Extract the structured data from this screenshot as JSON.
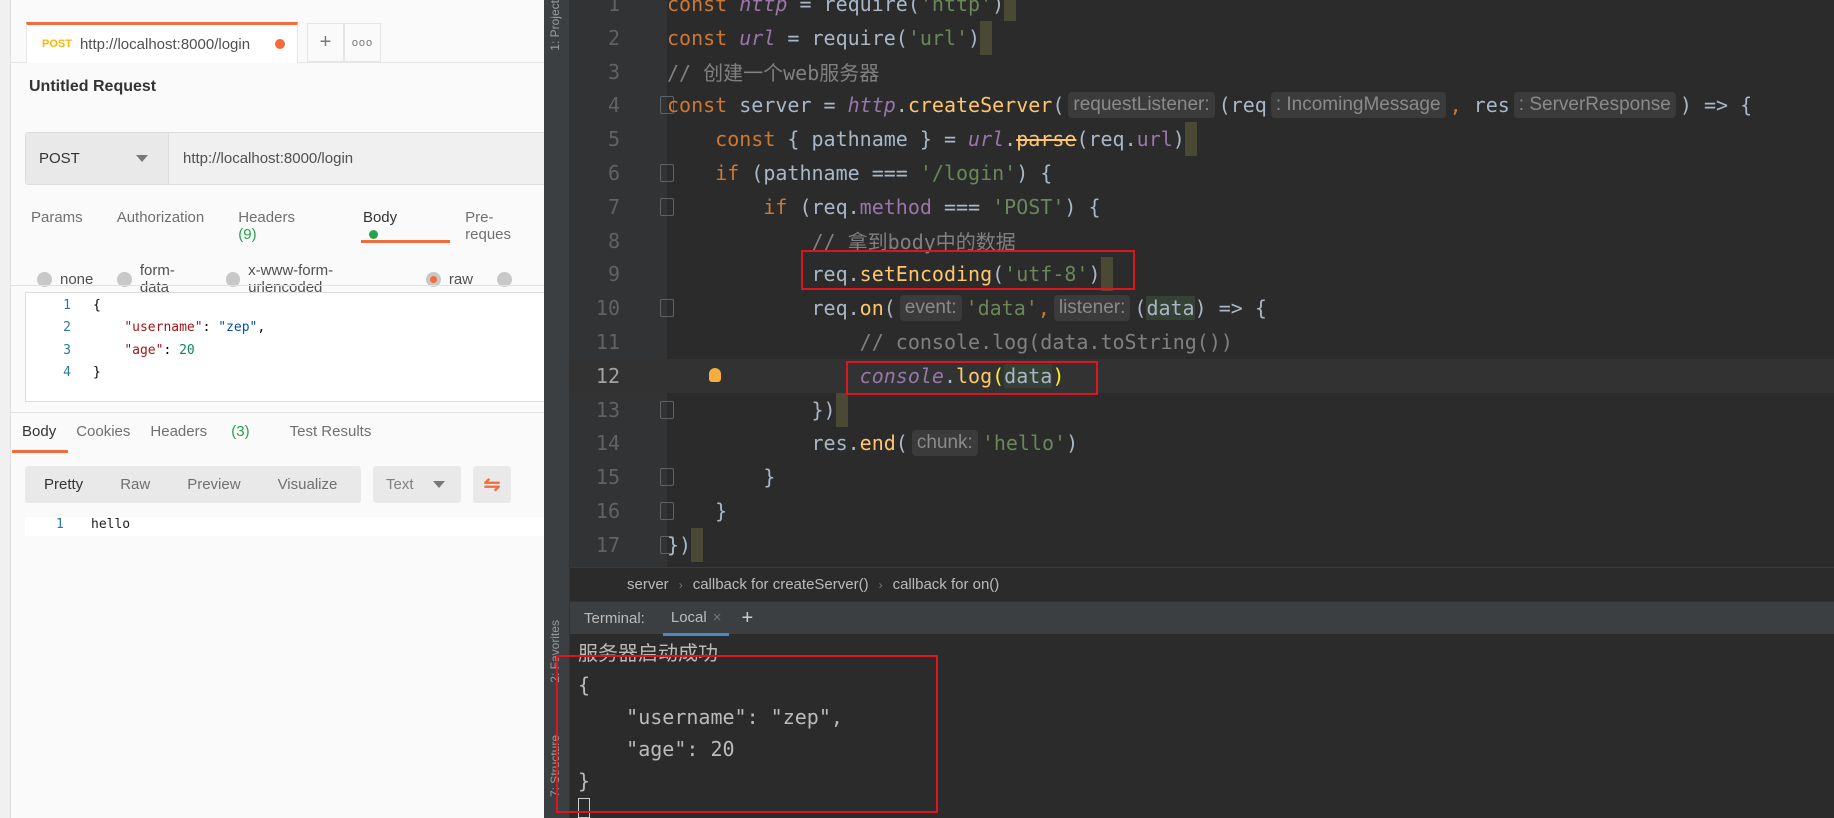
{
  "postman": {
    "tab": {
      "method": "POST",
      "url": "http://localhost:8000/login"
    },
    "new_tab_icon": "plus-icon",
    "more_icon": "ellipsis-icon",
    "title": "Untitled Request",
    "method": "POST",
    "url": "http://localhost:8000/login",
    "req_tabs": {
      "params": "Params",
      "authorization": "Authorization",
      "headers": "Headers",
      "headers_count": "(9)",
      "body": "Body",
      "prerequest": "Pre-reques"
    },
    "body_types": [
      "none",
      "form-data",
      "x-www-form-urlencoded",
      "raw"
    ],
    "selected_body_type": "raw",
    "body_lines": [
      {
        "n": "1",
        "parts": [
          [
            "p",
            "{"
          ]
        ]
      },
      {
        "n": "2",
        "parts": [
          [
            "p",
            "    "
          ],
          [
            "k",
            "\"username\""
          ],
          [
            "p",
            ": "
          ],
          [
            "s",
            "\"zep\""
          ],
          [
            "p",
            ","
          ]
        ]
      },
      {
        "n": "3",
        "parts": [
          [
            "p",
            "    "
          ],
          [
            "k",
            "\"age\""
          ],
          [
            "p",
            ": "
          ],
          [
            "num",
            "20"
          ]
        ]
      },
      {
        "n": "4",
        "parts": [
          [
            "p",
            "}"
          ]
        ]
      }
    ],
    "res_tabs": {
      "body": "Body",
      "cookies": "Cookies",
      "headers": "Headers",
      "headers_count": "(3)",
      "tests": "Test Results"
    },
    "views": [
      "Pretty",
      "Raw",
      "Preview",
      "Visualize"
    ],
    "format": "Text",
    "response": {
      "n": "1",
      "text": "hello"
    },
    "accent": "#f26b3a"
  },
  "ide": {
    "left_tools": {
      "project": "1: Project",
      "favorites": "2: Favorites",
      "structure": "7: Structure"
    },
    "code": [
      [
        [
          "kw",
          "const "
        ],
        [
          "glob",
          "http"
        ],
        [
          "p",
          " = require("
        ],
        [
          "str",
          "'http'"
        ],
        [
          "p",
          ")"
        ],
        [
          "hl",
          ""
        ]
      ],
      [
        [
          "kw",
          "const "
        ],
        [
          "glob",
          "url"
        ],
        [
          "p",
          " = require("
        ],
        [
          "str",
          "'url'"
        ],
        [
          "p",
          ")"
        ],
        [
          "hl",
          ""
        ]
      ],
      [
        [
          "cmt",
          "// 创建一个web服务器"
        ]
      ],
      [
        [
          "kw",
          "const "
        ],
        [
          "p",
          "server = "
        ],
        [
          "glob",
          "http"
        ],
        [
          "p",
          "."
        ],
        [
          "fn",
          "createServer"
        ],
        [
          "p",
          "("
        ],
        [
          "hint",
          "requestListener:"
        ],
        [
          "p",
          "(req"
        ],
        [
          "hint",
          ": IncomingMessage"
        ],
        [
          "kw",
          ","
        ],
        [
          "p",
          " res"
        ],
        [
          "hint",
          ": ServerResponse"
        ],
        [
          "p",
          ") => {"
        ]
      ],
      [
        [
          "p",
          "    "
        ],
        [
          "kw",
          "const "
        ],
        [
          "p",
          "{ pathname } = "
        ],
        [
          "glob",
          "url"
        ],
        [
          "p",
          "."
        ],
        [
          "fnstrike",
          "parse"
        ],
        [
          "p",
          "(req."
        ],
        [
          "prop",
          "url"
        ],
        [
          "p",
          ")"
        ],
        [
          "hl",
          ""
        ]
      ],
      [
        [
          "p",
          "    "
        ],
        [
          "kw",
          "if "
        ],
        [
          "p",
          "(pathname === "
        ],
        [
          "str",
          "'/login'"
        ],
        [
          "p",
          ") {"
        ]
      ],
      [
        [
          "p",
          "        "
        ],
        [
          "kw",
          "if "
        ],
        [
          "p",
          "(req."
        ],
        [
          "prop",
          "method"
        ],
        [
          "p",
          " === "
        ],
        [
          "str",
          "'POST'"
        ],
        [
          "p",
          ") {"
        ]
      ],
      [
        [
          "p",
          "            "
        ],
        [
          "cmt",
          "// 拿到body中的数据"
        ]
      ],
      [
        [
          "p",
          "            req."
        ],
        [
          "fn",
          "setEncoding"
        ],
        [
          "p",
          "("
        ],
        [
          "str",
          "'utf-8'"
        ],
        [
          "p",
          ")"
        ],
        [
          "hl",
          ""
        ]
      ],
      [
        [
          "p",
          "            req."
        ],
        [
          "fn",
          "on"
        ],
        [
          "p",
          "("
        ],
        [
          "hint",
          "event:"
        ],
        [
          "str",
          "'data'"
        ],
        [
          "kw",
          ","
        ],
        [
          "hint",
          "listener:"
        ],
        [
          "p",
          "("
        ],
        [
          "param",
          "data"
        ],
        [
          "p",
          ") => {"
        ]
      ],
      [
        [
          "p",
          "                "
        ],
        [
          "cmt",
          "// console.log(data.toString())"
        ]
      ],
      [
        [
          "p",
          "                "
        ],
        [
          "glob",
          "console"
        ],
        [
          "p",
          "."
        ],
        [
          "fn",
          "log"
        ],
        [
          "brace",
          "("
        ],
        [
          "param",
          "data"
        ],
        [
          "brace",
          ")"
        ]
      ],
      [
        [
          "p",
          "            })"
        ],
        [
          "hl",
          ""
        ]
      ],
      [
        [
          "p",
          "            res."
        ],
        [
          "fn",
          "end"
        ],
        [
          "p",
          "("
        ],
        [
          "hint",
          "chunk:"
        ],
        [
          "str",
          "'hello'"
        ],
        [
          "p",
          ")"
        ]
      ],
      [
        [
          "p",
          "        }"
        ]
      ],
      [
        [
          "p",
          "    }"
        ]
      ],
      [
        [
          "p",
          "})"
        ],
        [
          "hl",
          ""
        ]
      ]
    ],
    "current_line": 12,
    "breadcrumb": [
      "server",
      "callback for createServer()",
      "callback for on()"
    ],
    "terminal": {
      "label": "Terminal:",
      "tab": "Local",
      "lines": [
        "服务器启动成功",
        "{",
        "    \"username\": \"zep\",",
        "    \"age\": 20",
        "}"
      ]
    },
    "highlight_color": "#e0141e"
  }
}
